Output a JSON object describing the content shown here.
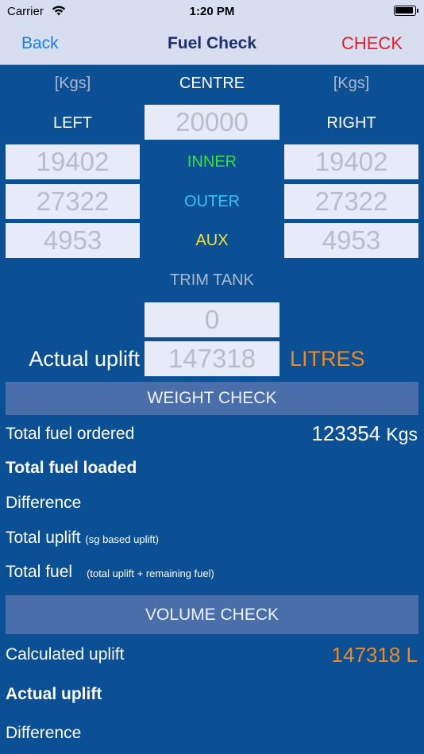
{
  "status": {
    "carrier": "Carrier",
    "time": "1:20 PM"
  },
  "nav": {
    "back": "Back",
    "title": "Fuel Check",
    "action": "CHECK"
  },
  "tanks": {
    "unit_left": "[Kgs]",
    "centre_label": "CENTRE",
    "unit_right": "[Kgs]",
    "left_label": "LEFT",
    "centre_value": "20000",
    "right_label": "RIGHT",
    "inner_label": "INNER",
    "left_inner": "19402",
    "right_inner": "19402",
    "outer_label": "OUTER",
    "left_outer": "27322",
    "right_outer": "27322",
    "aux_label": "AUX",
    "left_aux": "4953",
    "right_aux": "4953",
    "trim_label": "TRIM TANK",
    "trim_value": "0"
  },
  "uplift": {
    "label": "Actual uplift",
    "value": "147318",
    "unit": "LITRES"
  },
  "weight_check": {
    "header": "WEIGHT CHECK",
    "total_ordered_label": "Total fuel ordered",
    "total_ordered_value": "123354",
    "total_ordered_unit": "Kgs",
    "total_loaded_label": "Total fuel loaded",
    "difference_label": "Difference",
    "total_uplift_label": "Total uplift",
    "total_uplift_note": "(sg based uplift)",
    "total_fuel_label": "Total fuel",
    "total_fuel_note": "(total uplift + remaining fuel)"
  },
  "volume_check": {
    "header": "VOLUME CHECK",
    "calculated_label": "Calculated uplift",
    "calculated_value": "147318 L",
    "actual_label": "Actual uplift",
    "difference_label": "Difference"
  },
  "colors": {
    "background": "#0b4f94",
    "nav_background": "#d6deef",
    "back_link": "#1d7cf2",
    "check_action": "#e31d2b",
    "inner": "#39e03c",
    "outer": "#31c7f3",
    "aux": "#f4e035",
    "highlight": "#f08a1e"
  }
}
